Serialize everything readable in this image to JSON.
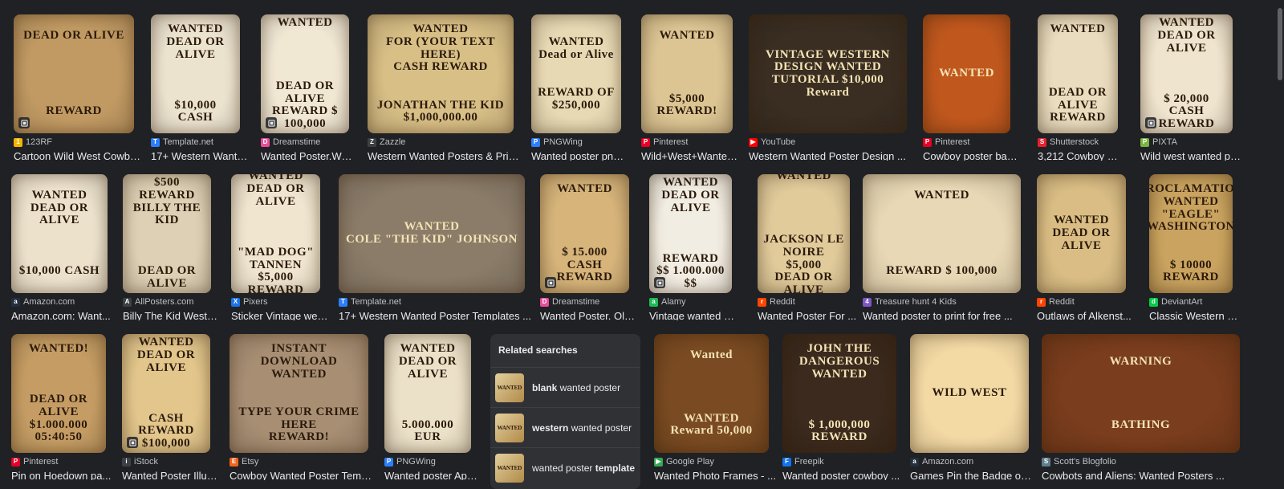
{
  "results": [
    {
      "source": "123RF",
      "title": "Cartoon Wild West Cowbo...",
      "thumb_text": "DEAD OR ALIVE\n\n\n\n\n\nREWARD",
      "bg": "#c19a63",
      "fav": "#f5b400",
      "fav_letter": "1"
    },
    {
      "source": "Template.net",
      "title": "17+ Western Wante...",
      "thumb_text": "WANTED\nDEAD OR ALIVE\n\n\n\n$10,000 CASH",
      "bg": "#ece3cf",
      "fav": "#2d7ff9",
      "fav_letter": "T"
    },
    {
      "source": "Dreamstime",
      "title": "Wanted Poster.Wes...",
      "thumb_text": "WANTED\n\n\n\n\nDEAD OR ALIVE\nREWARD $ 100,000",
      "bg": "#f1e8d4",
      "fav": "#e54e9a",
      "fav_letter": "D"
    },
    {
      "source": "Zazzle",
      "title": "Western Wanted Posters & Print...",
      "thumb_text": "WANTED\nFOR (YOUR TEXT HERE)\nCASH REWARD\n\n\nJONATHAN THE KID\n$1,000,000.00",
      "bg": "#d8bf86",
      "fav": "#3c4043",
      "fav_letter": "Z"
    },
    {
      "source": "PNGWing",
      "title": "Wanted poster png i...",
      "thumb_text": "WANTED\nDead or Alive\n\n\nREWARD OF\n$250,000",
      "bg": "#e7d9b3",
      "fav": "#2d7ff9",
      "fav_letter": "P"
    },
    {
      "source": "Pinterest",
      "title": "Wild+West+Wanted+...",
      "thumb_text": "WANTED\n\n\n\n\n$5,000 REWARD!",
      "bg": "#dcc593",
      "fav": "#e60023",
      "fav_letter": "P"
    },
    {
      "source": "YouTube",
      "title": "Western Wanted Poster Design ...",
      "thumb_text": "VINTAGE WESTERN DESIGN   WANTED\nTUTORIAL   $10,000 Reward",
      "bg": "#3a2e22",
      "fav": "#ff0000",
      "fav_letter": "▶"
    },
    {
      "source": "Pinterest",
      "title": "Cowboy poster bac...",
      "thumb_text": "WANTED",
      "bg": "#c0581e",
      "fav": "#e60023",
      "fav_letter": "P"
    },
    {
      "source": "Shutterstock",
      "title": "3,212 Cowboy Want...",
      "thumb_text": "WANTED\n\n\n\n\nDEAD OR ALIVE\nREWARD",
      "bg": "#eadcbe",
      "fav": "#e8212e",
      "fav_letter": "S"
    },
    {
      "source": "PIXTA",
      "title": "Wild west wanted po...",
      "thumb_text": "WANTED\nDEAD OR ALIVE\n\n\n\n$ 20,000\nCASH REWARD",
      "bg": "#efe4cd",
      "fav": "#7cb342",
      "fav_letter": "P"
    },
    {
      "source": "Amazon.com",
      "title": "Amazon.com: Want...",
      "thumb_text": "WANTED\nDEAD OR ALIVE\n\n\n\n$10,000 CASH",
      "bg": "#ece2cc",
      "fav": "#232f3e",
      "fav_letter": "a"
    },
    {
      "source": "AllPosters.com",
      "title": "Billy The Kid Wester...",
      "thumb_text": "$500 REWARD\nBILLY THE KID\n\n\n\nDEAD OR ALIVE",
      "bg": "#ddd0b4",
      "fav": "#3c4043",
      "fav_letter": "A"
    },
    {
      "source": "Pixers",
      "title": "Sticker Vintage wes...",
      "thumb_text": "WANTED\nDEAD OR ALIVE\n\n\n\n\"MAD DOG\" TANNEN\n$5,000 REWARD",
      "bg": "#f0e6cf",
      "fav": "#1a73e8",
      "fav_letter": "X"
    },
    {
      "source": "Template.net",
      "title": "17+ Western Wanted Poster Templates ...",
      "thumb_text": "WANTED\nCOLE \"THE KID\" JOHNSON",
      "bg": "#8b7c69",
      "fav": "#2d7ff9",
      "fav_letter": "T"
    },
    {
      "source": "Dreamstime",
      "title": "Wanted Poster. Old ...",
      "thumb_text": "WANTED\n\n\n\n\n$ 15.000\nCASH REWARD",
      "bg": "#d6b47a",
      "fav": "#e54e9a",
      "fav_letter": "D"
    },
    {
      "source": "Alamy",
      "title": "Vintage wanted pos...",
      "thumb_text": "WANTED\nDEAD OR ALIVE\n\n\n\nREWARD\n$$ 1.000.000 $$",
      "bg": "#f2ede2",
      "fav": "#1db954",
      "fav_letter": "a"
    },
    {
      "source": "Reddit",
      "title": "Wanted Poster For ...",
      "thumb_text": "WANTED\n\n\n\n\nJACKSON LE NOIRE\n$5,000\nDEAD OR ALIVE",
      "bg": "#e1cb9b",
      "fav": "#ff4500",
      "fav_letter": "r"
    },
    {
      "source": "Treasure hunt 4 Kids",
      "title": "Wanted poster to print for free ...",
      "thumb_text": "WANTED\n\n\n\n\n\nREWARD $ 100,000",
      "bg": "#e8d8b5",
      "fav": "#7e57c2",
      "fav_letter": "4"
    },
    {
      "source": "Reddit",
      "title": "Outlaws of Alkenst...",
      "thumb_text": "WANTED\nDEAD OR ALIVE",
      "bg": "#d9bd84",
      "fav": "#ff4500",
      "fav_letter": "r"
    },
    {
      "source": "DeviantArt",
      "title": "Classic Western W...",
      "thumb_text": "PROCLAMATION\nWANTED\n\"EAGLE\" WASHINGTON\n\n\n$ 10000\nREWARD",
      "bg": "#c9a35f",
      "fav": "#05cc47",
      "fav_letter": "d"
    },
    {
      "source": "Pinterest",
      "title": "Pin on Hoedown pa...",
      "thumb_text": "WANTED!\n\n\n\nDEAD OR ALIVE\n$1.000.000\n05:40:50",
      "bg": "#c59d64",
      "fav": "#e60023",
      "fav_letter": "P"
    },
    {
      "source": "iStock",
      "title": "Wanted Poster Illus...",
      "thumb_text": "WANTED\nDEAD OR ALIVE\n\n\n\nCASH REWARD\n$100,000",
      "bg": "#e2c68c",
      "fav": "#3c4043",
      "fav_letter": "i"
    },
    {
      "source": "Etsy",
      "title": "Cowboy Wanted Poster Templ...",
      "thumb_text": "INSTANT DOWNLOAD\nWANTED\n\n\nTYPE YOUR CRIME HERE\nREWARD!",
      "bg": "#a88f74",
      "fav": "#f1641e",
      "fav_letter": "E"
    },
    {
      "source": "PNGWing",
      "title": "Wanted poster Appl...",
      "thumb_text": "WANTED\nDEAD OR ALIVE\n\n\n\n5.000.000 EUR",
      "bg": "#ebe1c8",
      "fav": "#2d7ff9",
      "fav_letter": "P"
    },
    {
      "source": "Google Play",
      "title": "Wanted Photo Frames - ...",
      "thumb_text": "Wanted\n\n\n\n\nWANTED\nReward 50,000",
      "bg": "#7a4b22",
      "fav": "#34a853",
      "fav_letter": "▶"
    },
    {
      "source": "Freepik",
      "title": "Wanted poster cowboy ...",
      "thumb_text": "JOHN THE DANGEROUS\nWANTED\n\n\n\n$ 1,000,000\nREWARD",
      "bg": "#3b2a1d",
      "fav": "#1273eb",
      "fav_letter": "F"
    },
    {
      "source": "Amazon.com",
      "title": "Games Pin the Badge on ...",
      "thumb_text": "WILD WEST",
      "bg": "#f3d9a4",
      "fav": "#232f3e",
      "fav_letter": "a"
    },
    {
      "source": "Scott's Blogfolio",
      "title": "Cowbots and Aliens: Wanted Posters ...",
      "thumb_text": "WARNING\n\n\n\n\nBATHING",
      "bg": "#7a3d1d",
      "fav": "#607d8b",
      "fav_letter": "S"
    }
  ],
  "related": {
    "heading": "Related searches",
    "items": [
      {
        "bold_first": true,
        "bold": "blank",
        "rest": " wanted poster",
        "thumb": "WANTED"
      },
      {
        "bold_first": true,
        "bold": "western",
        "rest": " wanted poster",
        "thumb": "WANTED"
      },
      {
        "bold_first": false,
        "rest": "wanted poster ",
        "bold": "template",
        "thumb": "WANTED"
      }
    ]
  }
}
